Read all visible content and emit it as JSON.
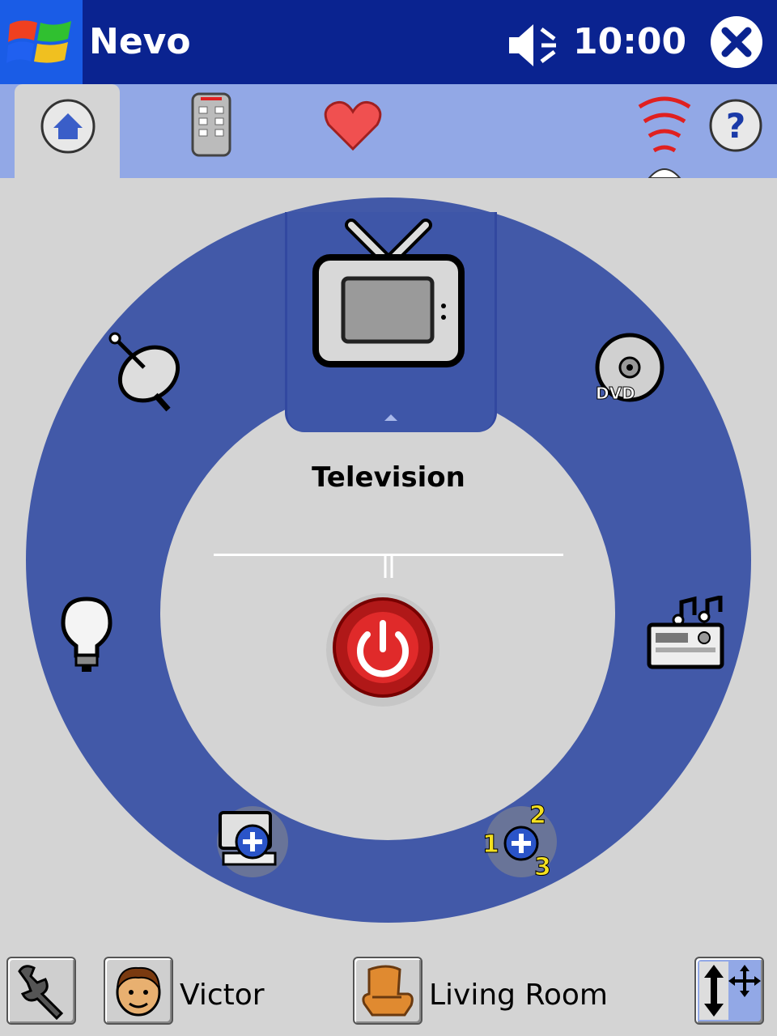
{
  "titlebar": {
    "app_title": "Nevo",
    "clock": "10:00",
    "start_icon": "windows-flag-icon",
    "volume_icon": "speaker-muted-icon",
    "close_icon": "close-x-icon"
  },
  "tabs": [
    {
      "name": "home",
      "icon": "home-icon",
      "selected": true
    },
    {
      "name": "remote",
      "icon": "remote-control-icon",
      "selected": false
    },
    {
      "name": "favorites",
      "icon": "heart-icon",
      "selected": false
    }
  ],
  "status_icons": {
    "signal": "ir-signal-icon",
    "help": "help-question-icon"
  },
  "wheel": {
    "selected_device": "Television",
    "devices": [
      {
        "name": "satellite",
        "icon": "satellite-dish-icon"
      },
      {
        "name": "television",
        "icon": "tv-icon"
      },
      {
        "name": "dvd",
        "icon": "dvd-disc-icon",
        "badge": "DVD"
      },
      {
        "name": "audio",
        "icon": "stereo-receiver-icon"
      },
      {
        "name": "activity-add",
        "icon": "add-activity-icon",
        "numbers": [
          "1",
          "2",
          "3"
        ]
      },
      {
        "name": "device-add",
        "icon": "add-device-icon"
      },
      {
        "name": "lights",
        "icon": "light-bulb-icon"
      }
    ],
    "power_icon": "power-icon"
  },
  "bottom": {
    "settings_icon": "wrench-icon",
    "user_name": "Victor",
    "user_icon": "user-face-icon",
    "room_name": "Living Room",
    "room_icon": "armchair-icon",
    "layout_icon": "move-arrows-icon"
  },
  "colors": {
    "titlebar": "#0a2390",
    "tabbar": "#92a8e6",
    "wheel": "#4259a8",
    "background": "#d4d4d4"
  }
}
